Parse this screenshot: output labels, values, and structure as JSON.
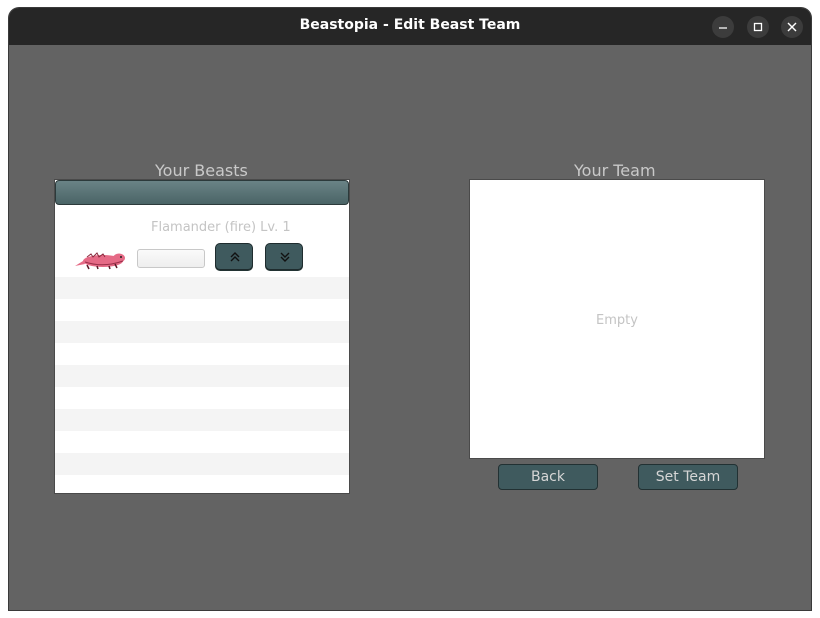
{
  "window": {
    "title": "Beastopia - Edit Beast Team",
    "controls": [
      "minimize-icon",
      "maximize-icon",
      "close-icon"
    ]
  },
  "beasts_panel": {
    "label": "Your Beasts",
    "items": [
      {
        "name": "Flamander (fire) Lv. 1",
        "sprite": "flamander-sprite"
      }
    ]
  },
  "team_panel": {
    "label": "Your Team",
    "empty_text": "Empty"
  },
  "buttons": {
    "back": "Back",
    "set_team": "Set Team"
  },
  "colors": {
    "background": "#636363",
    "titlebar": "#262626",
    "button": "#3f5a5e"
  }
}
